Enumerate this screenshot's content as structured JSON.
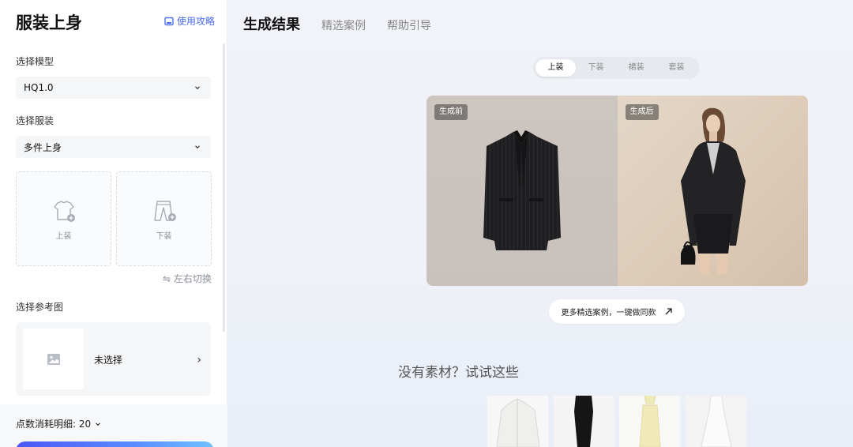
{
  "sidebar": {
    "title": "服装上身",
    "guide_label": "使用攻略",
    "model_label": "选择模型",
    "model_value": "HQ1.0",
    "garment_label": "选择服装",
    "garment_value": "多件上身",
    "slots": [
      {
        "label": "上装",
        "icon": "top-garment-add-icon"
      },
      {
        "label": "下装",
        "icon": "pants-add-icon"
      }
    ],
    "swap_label": "⇋ 左右切换",
    "reference_label": "选择参考图",
    "reference_value": "未选择",
    "points_label": "点数消耗明细: 20"
  },
  "main": {
    "tabs": [
      {
        "label": "生成结果",
        "active": true
      },
      {
        "label": "精选案例",
        "active": false
      },
      {
        "label": "帮助引导",
        "active": false
      }
    ],
    "segments": [
      {
        "label": "上装",
        "active": true
      },
      {
        "label": "下装",
        "active": false
      },
      {
        "label": "裙装",
        "active": false
      },
      {
        "label": "套装",
        "active": false
      }
    ],
    "before_tag": "生成前",
    "after_tag": "生成后",
    "more_cases_label": "更多精选案例，一键做同款",
    "try_title": "没有素材？试试这些"
  },
  "colors": {
    "accent": "#4a6cf7",
    "button_gradient_start": "#4b57f5",
    "button_gradient_end": "#6fc2ff"
  }
}
